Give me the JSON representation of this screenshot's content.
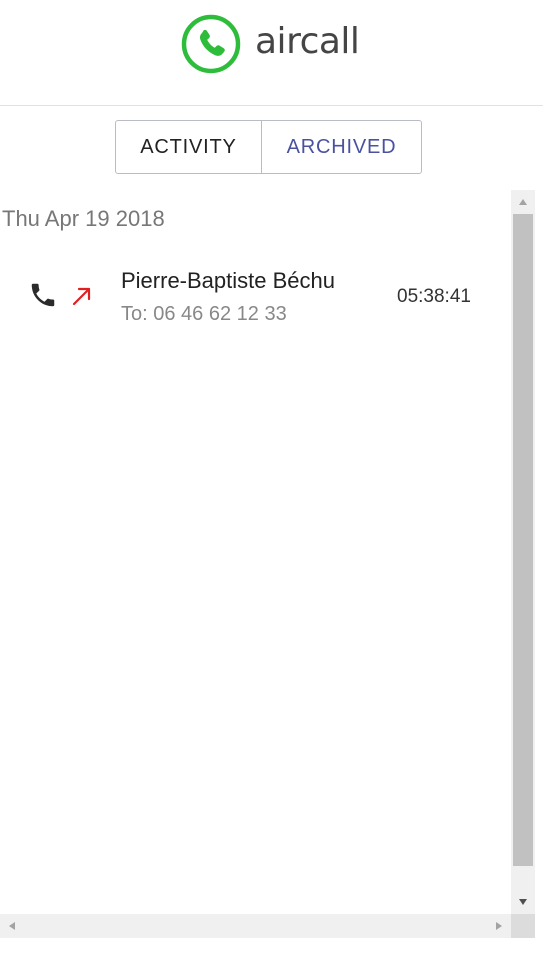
{
  "header": {
    "logo_text": "aircall",
    "brand_color": "#2ebd3b"
  },
  "tabs": [
    {
      "label": "ACTIVITY",
      "active": false
    },
    {
      "label": "ARCHIVED",
      "active": true
    }
  ],
  "colors": {
    "active_tab": "#4a52a0",
    "outgoing_arrow": "#e02020",
    "phone_icon": "#2b2b2b"
  },
  "activity": {
    "groups": [
      {
        "date": "Thu Apr 19 2018",
        "calls": [
          {
            "direction_icon": "outgoing-arrow-icon",
            "contact_name": "Pierre-Baptiste Béchu",
            "number": "To: 06 46 62 12 33",
            "time": "05:38:41"
          }
        ]
      }
    ]
  }
}
